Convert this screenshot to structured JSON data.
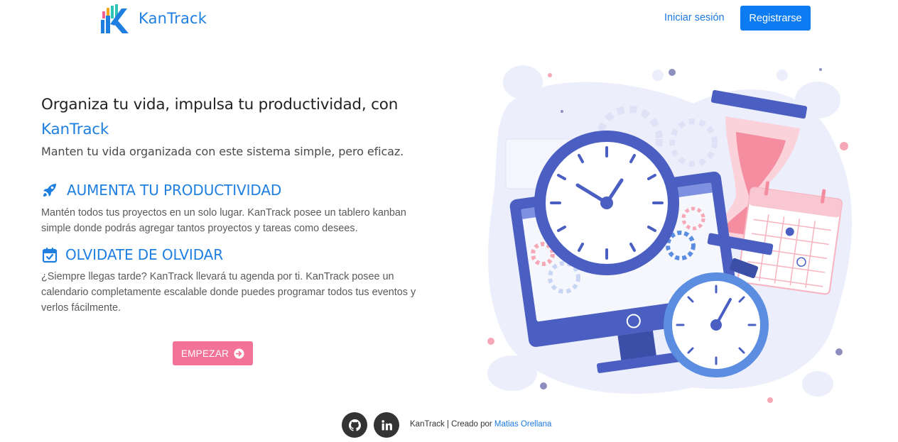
{
  "navbar": {
    "brand_name": "KanTrack",
    "login_label": "Iniciar sesión",
    "register_label": "Registrarse"
  },
  "hero": {
    "title_main": "Organiza tu vida, impulsa tu productividad, con",
    "title_accent": "KanTrack",
    "subtitle": "Manten tu vida organizada con este sistema simple, pero eficaz."
  },
  "features": [
    {
      "icon": "rocket-icon",
      "title": "AUMENTA TU PRODUCTIVIDAD",
      "text": "Mantén todos tus proyectos en un solo lugar. KanTrack posee un tablero kanban simple donde podrás agregar tantos proyectos y tareas como desees."
    },
    {
      "icon": "calendar-check-icon",
      "title": "OLVIDATE DE OLVIDAR",
      "text": "¿Siempre llegas tarde? KanTrack llevará tu agenda por ti. KanTrack posee un calendario completamente escalable donde puedes programar todos tus eventos y verlos fácilmente."
    }
  ],
  "cta": {
    "label": "EMPEZAR",
    "icon": "arrow-circle-right-icon"
  },
  "footer": {
    "social": [
      "github-icon",
      "linkedin-icon"
    ],
    "text": "KanTrack | Creado por",
    "author": "Matias Orellana"
  },
  "colors": {
    "brand_blue": "#1f7fe0",
    "button_blue": "#0d7cf2",
    "cta_pink": "#f37398",
    "illustration_indigo": "#4a5fc1",
    "illustration_pink": "#f48c9e",
    "footer_icon_bg": "#333333"
  }
}
